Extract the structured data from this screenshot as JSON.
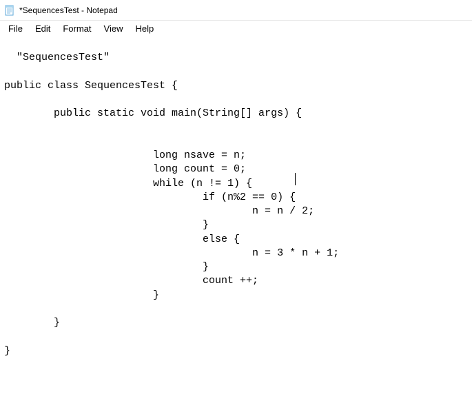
{
  "window": {
    "title": "*SequencesTest - Notepad"
  },
  "menu": {
    "file": "File",
    "edit": "Edit",
    "format": "Format",
    "view": "View",
    "help": "Help"
  },
  "editor": {
    "content": "\"SequencesTest\"\n\npublic class SequencesTest {\n\n        public static void main(String[] args) {\n\n\n                        long nsave = n;\n                        long count = 0;\n                        while (n != 1) {\n                                if (n%2 == 0) {\n                                        n = n / 2;\n                                }\n                                else {\n                                        n = 3 * n + 1;\n                                }\n                                count ++;\n                        }\n\n        }\n\n}"
  }
}
